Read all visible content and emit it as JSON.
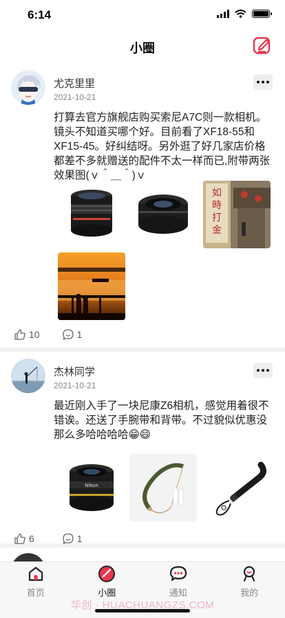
{
  "status": {
    "time": "6:14"
  },
  "nav": {
    "title": "小圈",
    "edit_icon": "edit-icon"
  },
  "posts": [
    {
      "username": "尤克里里",
      "date": "2021-10-21",
      "text": "打算去官方旗舰店购买索尼A7C则一款相机。镜头不知道买哪个好。目前看了XF18-55和XF15-45。好纠结呀。另外逛了好几家店价格都差不多就赠送的配件不太一样而已,附带两张效果图(ｖ＾＿＾)ｖ",
      "images": [
        "lens-xf18-55-image",
        "lens-xf15-45-image",
        "street-shop-image",
        "sunset-pier-image"
      ],
      "likes": "10",
      "comments": "1"
    },
    {
      "username": "杰林同学",
      "date": "2021-10-21",
      "text": "最近刚入手了一块尼康Z6相机，感觉用着很不错诶。还送了手腕带和背带。不过貌似优惠没那么多哈哈哈哈😁😄",
      "images": [
        "nikon-lens-image",
        "camera-strap-image",
        "wrist-strap-image"
      ],
      "likes": "6",
      "comments": "1"
    }
  ],
  "tabs": [
    {
      "label": "首页",
      "icon": "home-icon",
      "active": false
    },
    {
      "label": "小圈",
      "icon": "circle-icon",
      "active": true
    },
    {
      "label": "通知",
      "icon": "message-icon",
      "active": false
    },
    {
      "label": "我的",
      "icon": "profile-icon",
      "active": false
    }
  ],
  "watermark": "华创 · HUACHUANGZS.COM",
  "colors": {
    "accent": "#e8364b",
    "background": "#ffffff",
    "divider": "#f2f2f5"
  }
}
